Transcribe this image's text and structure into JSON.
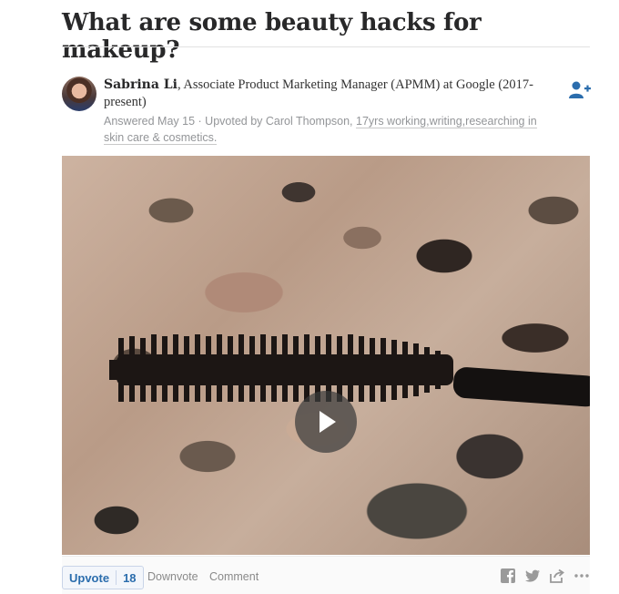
{
  "question": {
    "title": "What are some beauty hacks for makeup?"
  },
  "answer": {
    "author": {
      "name": "Sabrina Li",
      "credential": ", Associate Product Marketing Manager (APMM) at Google (2017-present)"
    },
    "meta": {
      "answered": "Answered May 15",
      "upvoted_prefix": " · Upvoted by Carol Thompson, ",
      "upvoter_credential": "17yrs working,writing,researching in skin care & cosmetics."
    },
    "video": {
      "thumbnail": "mascara wand over granite countertop",
      "play_icon": "play-icon"
    }
  },
  "actions": {
    "upvote_label": "Upvote",
    "upvote_count": "18",
    "downvote_label": "Downvote",
    "comment_label": "Comment"
  },
  "icons": [
    "follow-user-icon",
    "facebook-icon",
    "twitter-icon",
    "share-icon",
    "more-icon"
  ],
  "colors": {
    "accent": "#2b6dad",
    "meta_text": "#939598",
    "title": "#282829"
  }
}
